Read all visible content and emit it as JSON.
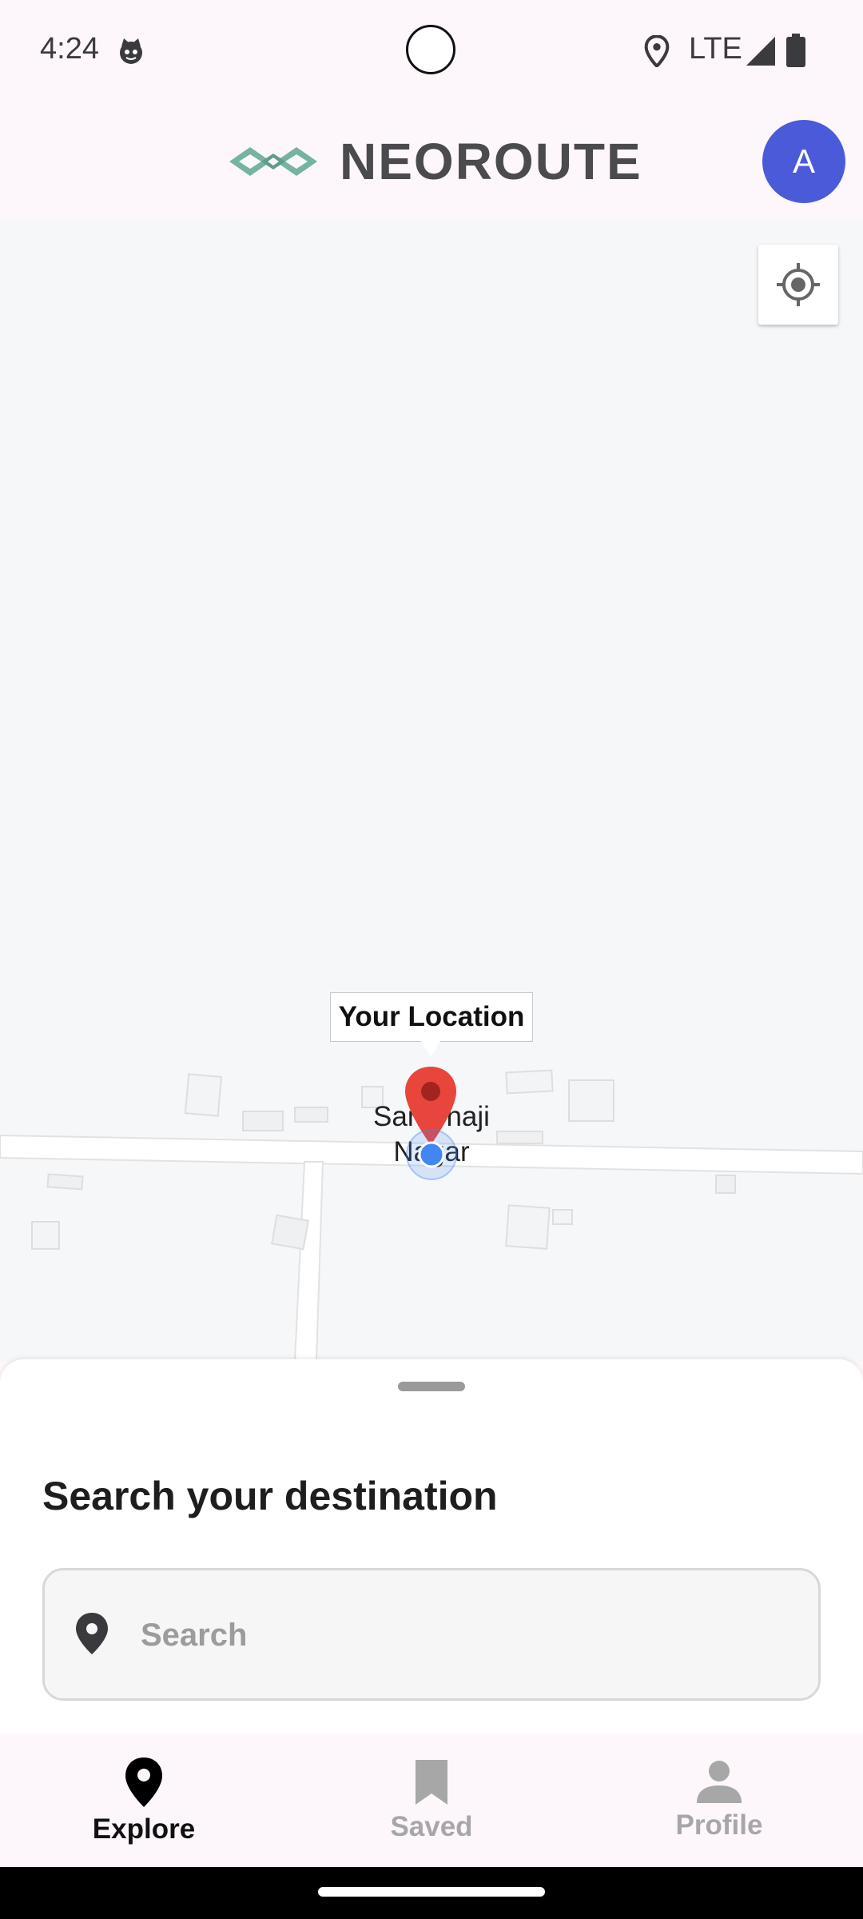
{
  "status_bar": {
    "time": "4:24",
    "network": "LTE",
    "icons": [
      "cat-notification-icon",
      "location-icon",
      "signal-icon",
      "battery-icon"
    ]
  },
  "header": {
    "brand": "NEOROUTE",
    "avatar_initial": "A",
    "avatar_color": "#4a5ad9"
  },
  "map": {
    "callout": "Your Location",
    "place_label": "Sambhaji Nagar",
    "pin_color": "#e8453c",
    "user_dot_color": "#4285f4"
  },
  "sheet": {
    "title": "Search your destination",
    "search_placeholder": "Search"
  },
  "nav": {
    "items": [
      {
        "label": "Explore",
        "icon": "map-pin-icon",
        "active": true
      },
      {
        "label": "Saved",
        "icon": "bookmark-icon",
        "active": false
      },
      {
        "label": "Profile",
        "icon": "person-icon",
        "active": false
      }
    ]
  }
}
